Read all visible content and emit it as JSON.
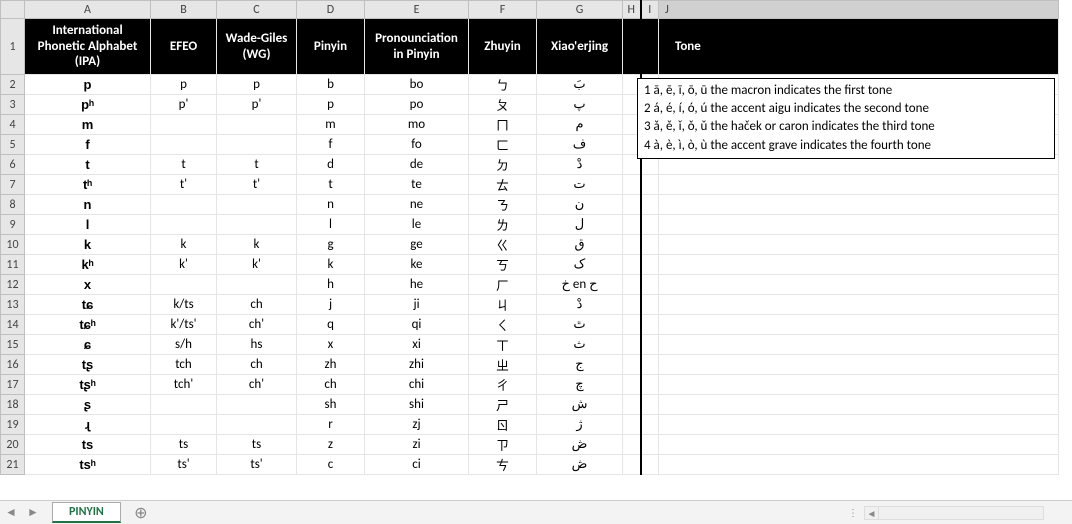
{
  "columns": [
    "A",
    "B",
    "C",
    "D",
    "E",
    "F",
    "G",
    "H",
    "I",
    "J"
  ],
  "selected_col": "J",
  "headers": {
    "A": "International Phonetic Alphabet (IPA)",
    "B": "EFEO",
    "C": "Wade-Giles (WG)",
    "D": "Pinyin",
    "E": "Pronounciation in Pinyin",
    "F": "Zhuyin",
    "G": "Xiao'erjing",
    "J": "Tone"
  },
  "rows": [
    {
      "n": 2,
      "A": "p",
      "B": "p",
      "C": "p",
      "D": "b",
      "E": "bo",
      "F": "ㄅ",
      "G": "بَ"
    },
    {
      "n": 3,
      "A": "pʰ",
      "B": "p'",
      "C": "p'",
      "D": "p",
      "E": "po",
      "F": "ㄆ",
      "G": "پ"
    },
    {
      "n": 4,
      "A": "m",
      "B": "",
      "C": "",
      "D": "m",
      "E": "mo",
      "F": "ㄇ",
      "G": "م"
    },
    {
      "n": 5,
      "A": "f",
      "B": "",
      "C": "",
      "D": "f",
      "E": "fo",
      "F": "ㄈ",
      "G": "ف"
    },
    {
      "n": 6,
      "A": "t",
      "B": "t",
      "C": "t",
      "D": "d",
      "E": "de",
      "F": "ㄉ",
      "G": "دْ"
    },
    {
      "n": 7,
      "A": "tʰ",
      "B": "t'",
      "C": "t'",
      "D": "t",
      "E": "te",
      "F": "ㄊ",
      "G": "ت"
    },
    {
      "n": 8,
      "A": "n",
      "B": "",
      "C": "",
      "D": "n",
      "E": "ne",
      "F": "ㄋ",
      "G": "ن"
    },
    {
      "n": 9,
      "A": "l",
      "B": "",
      "C": "",
      "D": "l",
      "E": "le",
      "F": "ㄌ",
      "G": "ل"
    },
    {
      "n": 10,
      "A": "k",
      "B": "k",
      "C": "k",
      "D": "g",
      "E": "ge",
      "F": "ㄍ",
      "G": "ق"
    },
    {
      "n": 11,
      "A": "kʰ",
      "B": "k'",
      "C": "k'",
      "D": "k",
      "E": "ke",
      "F": "ㄎ",
      "G": "ک"
    },
    {
      "n": 12,
      "A": "x",
      "B": "",
      "C": "",
      "D": "h",
      "E": "he",
      "F": "ㄏ",
      "G": "خ en ح"
    },
    {
      "n": 13,
      "A": "tɕ",
      "B": "k/ts",
      "C": "ch",
      "D": "j",
      "E": "ji",
      "F": "ㄐ",
      "G": "دْ"
    },
    {
      "n": 14,
      "A": "tɕʰ",
      "B": "k'/ts'",
      "C": "ch'",
      "D": "q",
      "E": "qi",
      "F": "ㄑ",
      "G": "ٿ"
    },
    {
      "n": 15,
      "A": "ɕ",
      "B": "s/h",
      "C": "hs",
      "D": "x",
      "E": "xi",
      "F": "ㄒ",
      "G": "ث"
    },
    {
      "n": 16,
      "A": "tʂ",
      "B": "tch",
      "C": "ch",
      "D": "zh",
      "E": "zhi",
      "F": "ㄓ",
      "G": "ج"
    },
    {
      "n": 17,
      "A": "tʂʰ",
      "B": "tch'",
      "C": "ch'",
      "D": "ch",
      "E": "chi",
      "F": "ㄔ",
      "G": "چ"
    },
    {
      "n": 18,
      "A": "ʂ",
      "B": "",
      "C": "",
      "D": "sh",
      "E": "shi",
      "F": "ㄕ",
      "G": "ش"
    },
    {
      "n": 19,
      "A": "ɻ",
      "B": "",
      "C": "",
      "D": "r",
      "E": "zj",
      "F": "ㄖ",
      "G": "ژ"
    },
    {
      "n": 20,
      "A": "ts",
      "B": "ts",
      "C": "ts",
      "D": "z",
      "E": "zi",
      "F": "ㄗ",
      "G": "ڞ"
    },
    {
      "n": 21,
      "A": "tsʰ",
      "B": "ts'",
      "C": "ts'",
      "D": "c",
      "E": "ci",
      "F": "ㄘ",
      "G": "ڞ"
    }
  ],
  "tone_box": [
    "1 ā, ē, ī, ō, ū the macron indicates the first tone",
    "2 á, é, í, ó, ú the accent aigu indicates the second tone",
    "3 ǎ, ě, ǐ, ǒ, ǔ the haček or caron indicates the third tone",
    "4 à, è, ì, ò, ù the accent grave indicates the fourth tone"
  ],
  "tabs": {
    "active": "PINYIN"
  },
  "icons": {
    "prev": "◄",
    "next": "►",
    "add": "⊕",
    "split": "⋮",
    "scroll_left": "◄"
  }
}
